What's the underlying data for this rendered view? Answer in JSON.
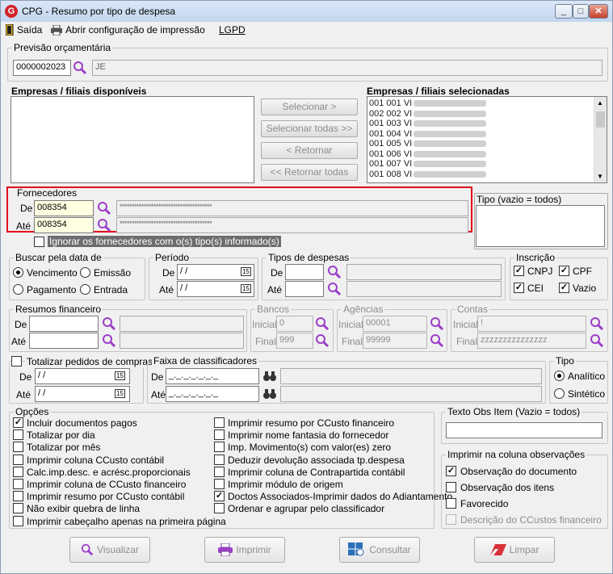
{
  "window": {
    "title": "CPG - Resumo por tipo de despesa",
    "logo_letter": "G",
    "btn_min": "_",
    "btn_max": "□",
    "btn_close": "✕"
  },
  "menu": {
    "saida": "Saída",
    "abrir_config": "Abrir configuração de impressão",
    "lgpd": "LGPD"
  },
  "previsao": {
    "label": "Previsão orçamentária",
    "code": "0000002023",
    "name": "JE"
  },
  "empresas": {
    "disponiveis_label": "Empresas / filiais disponíveis",
    "selecionadas_label": "Empresas / filiais selecionadas",
    "selecionadas_items": [
      "001 001 VI",
      "002 002 VI",
      "001 003 VI",
      "001 004 VI",
      "001 005 VI",
      "001 006 VI",
      "001 007 VI",
      "001 008 VI"
    ],
    "btn_selecionar": "Selecionar >",
    "btn_selecionar_todas": "Selecionar todas >>",
    "btn_retornar": "< Retornar",
    "btn_retornar_todas": "<< Retornar todas"
  },
  "fornecedores": {
    "label": "Fornecedores",
    "de_label": "De",
    "de_value": "008354",
    "de_name": "**************************************",
    "ate_label": "Até",
    "ate_value": "008354",
    "ate_name": "**************************************",
    "ignorar_label": "Ignorar os fornecedores com o(s) tipo(s) informado(s)"
  },
  "tipo_vazio": {
    "label": "Tipo (vazio = todos)"
  },
  "buscar": {
    "label": "Buscar pela data de",
    "vencimento": "Vencimento",
    "emissao": "Emissão",
    "pagamento": "Pagamento",
    "entrada": "Entrada"
  },
  "periodo": {
    "label": "Período",
    "de_label": "De",
    "de_value": " / /",
    "ate_label": "Até",
    "ate_value": " / /"
  },
  "tipos_despesas": {
    "label": "Tipos de despesas",
    "de_label": "De",
    "ate_label": "Até"
  },
  "inscricao": {
    "label": "Inscrição",
    "cnpj": "CNPJ",
    "cpf": "CPF",
    "cei": "CEI",
    "vazio": "Vazio"
  },
  "resumos": {
    "label": "Resumos financeiro",
    "de_label": "De",
    "ate_label": "Até"
  },
  "bancos": {
    "label": "Bancos",
    "inicial_label": "Inicial",
    "inicial_value": "0",
    "final_label": "Final",
    "final_value": "999"
  },
  "agencias": {
    "label": "Agências",
    "inicial_label": "Inicial",
    "inicial_value": "00001",
    "final_label": "Final",
    "final_value": "99999"
  },
  "contas": {
    "label": "Contas",
    "inicial_label": "Inicial",
    "inicial_value": "!",
    "final_label": "Final",
    "final_value": "zzzzzzzzzzzzzzz"
  },
  "totalizar": {
    "label": "Totalizar pedidos de compras",
    "de_label": "De",
    "de_value": " / /",
    "ate_label": "Até",
    "ate_value": " / /"
  },
  "faixa": {
    "label": "Faixa de classificadores",
    "de_label": "De",
    "de_value": "_._._._._._._",
    "ate_label": "Até",
    "ate_value": "_._._._._._._"
  },
  "tipo": {
    "label": "Tipo",
    "analitico": "Analítico",
    "sintetico": "Sintético"
  },
  "opcoes": {
    "label": "Opções",
    "col1": [
      {
        "label": "Incluir documentos pagos",
        "checked": true
      },
      {
        "label": "Totalizar por dia",
        "checked": false
      },
      {
        "label": "Totalizar por mês",
        "checked": false
      },
      {
        "label": "Imprimir coluna CCusto contábil",
        "checked": false
      },
      {
        "label": "Calc.imp.desc. e acrésc.proporcionais",
        "checked": false
      },
      {
        "label": "Imprimir coluna de CCusto financeiro",
        "checked": false
      },
      {
        "label": "Imprimir resumo por CCusto contábil",
        "checked": false
      },
      {
        "label": "Não exibir quebra de linha",
        "checked": false
      },
      {
        "label": "Imprimir cabeçalho apenas na primeira página",
        "checked": false
      }
    ],
    "col2": [
      {
        "label": "Imprimir resumo por CCusto financeiro",
        "checked": false
      },
      {
        "label": "Imprimir nome fantasia do fornecedor",
        "checked": false
      },
      {
        "label": "Imp. Movimento(s) com valor(es) zero",
        "checked": false
      },
      {
        "label": "Deduzir devolução associada tp.despesa",
        "checked": false
      },
      {
        "label": "Imprimir coluna de Contrapartida contábil",
        "checked": false
      },
      {
        "label": "Imprimir módulo de origem",
        "checked": false
      },
      {
        "label": "Doctos Associados-Imprimir dados do Adiantamento",
        "checked": true
      },
      {
        "label": "Ordenar e agrupar pelo classificador",
        "checked": false
      }
    ]
  },
  "texto_obs": {
    "label": "Texto Obs Item (Vazio = todos)"
  },
  "imprimir_obs": {
    "label": "Imprimir na coluna observações",
    "obs_documento": "Observação do documento",
    "obs_itens": "Observação dos itens",
    "favorecido": "Favorecido",
    "descricao": "Descrição do CCustos financeiro"
  },
  "actions": {
    "visualizar": "Visualizar",
    "imprimir": "Imprimir",
    "consultar": "Consultar",
    "limpar": "Limpar"
  },
  "colors": {
    "highlight_border": "#e0001a",
    "magnifier": "#9b3ec8"
  }
}
